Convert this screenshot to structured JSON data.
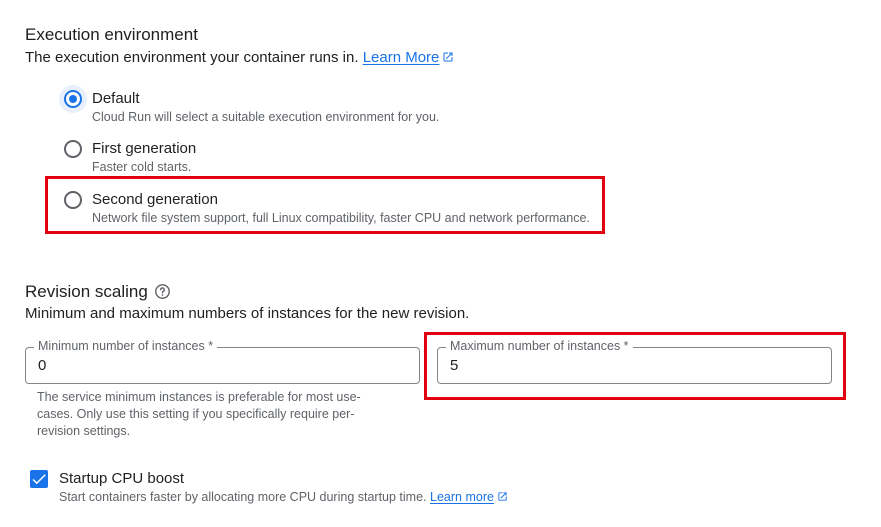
{
  "execution": {
    "title": "Execution environment",
    "subtitle": "The execution environment your container runs in.",
    "learn_more": "Learn More",
    "options": [
      {
        "label": "Default",
        "description": "Cloud Run will select a suitable execution environment for you.",
        "selected": true
      },
      {
        "label": "First generation",
        "description": "Faster cold starts.",
        "selected": false
      },
      {
        "label": "Second generation",
        "description": "Network file system support, full Linux compatibility, faster CPU and network performance.",
        "selected": false
      }
    ]
  },
  "scaling": {
    "title": "Revision scaling",
    "subtitle": "Minimum and maximum numbers of instances for the new revision.",
    "min": {
      "label": "Minimum number of instances *",
      "value": "0"
    },
    "max": {
      "label": "Maximum number of instances *",
      "value": "5"
    },
    "min_hint": "The service minimum instances is preferable for most use-cases. Only use this setting if you specifically require per-revision settings."
  },
  "startup_boost": {
    "label": "Startup CPU boost",
    "description": "Start containers faster by allocating more CPU during startup time.",
    "learn_more": "Learn more",
    "checked": true
  },
  "colors": {
    "accent": "#1a73e8",
    "highlight": "#e0000f",
    "muted": "#5f6368"
  }
}
